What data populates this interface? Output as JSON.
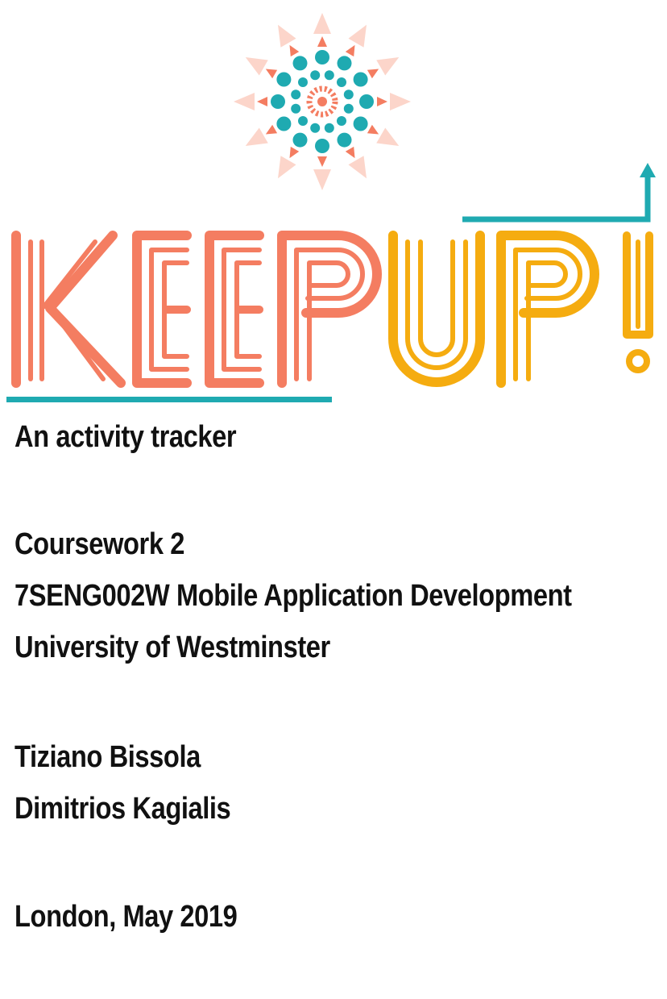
{
  "logo": {
    "word_left": "KEEP",
    "word_right": "UP!",
    "colors": {
      "coral": "#f47d61",
      "coral_light": "#f9b29e",
      "teal": "#1faab1",
      "yellow": "#f5ac10"
    },
    "emblem_icon": "sunburst-dots-icon"
  },
  "subtitle": "An activity tracker",
  "course": {
    "line1": "Coursework 2",
    "line2": "7SENG002W Mobile Application Development",
    "line3": "University of Westminster"
  },
  "authors": [
    "Tiziano Bissola",
    "Dimitrios Kagialis"
  ],
  "place_date": "London, May 2019"
}
